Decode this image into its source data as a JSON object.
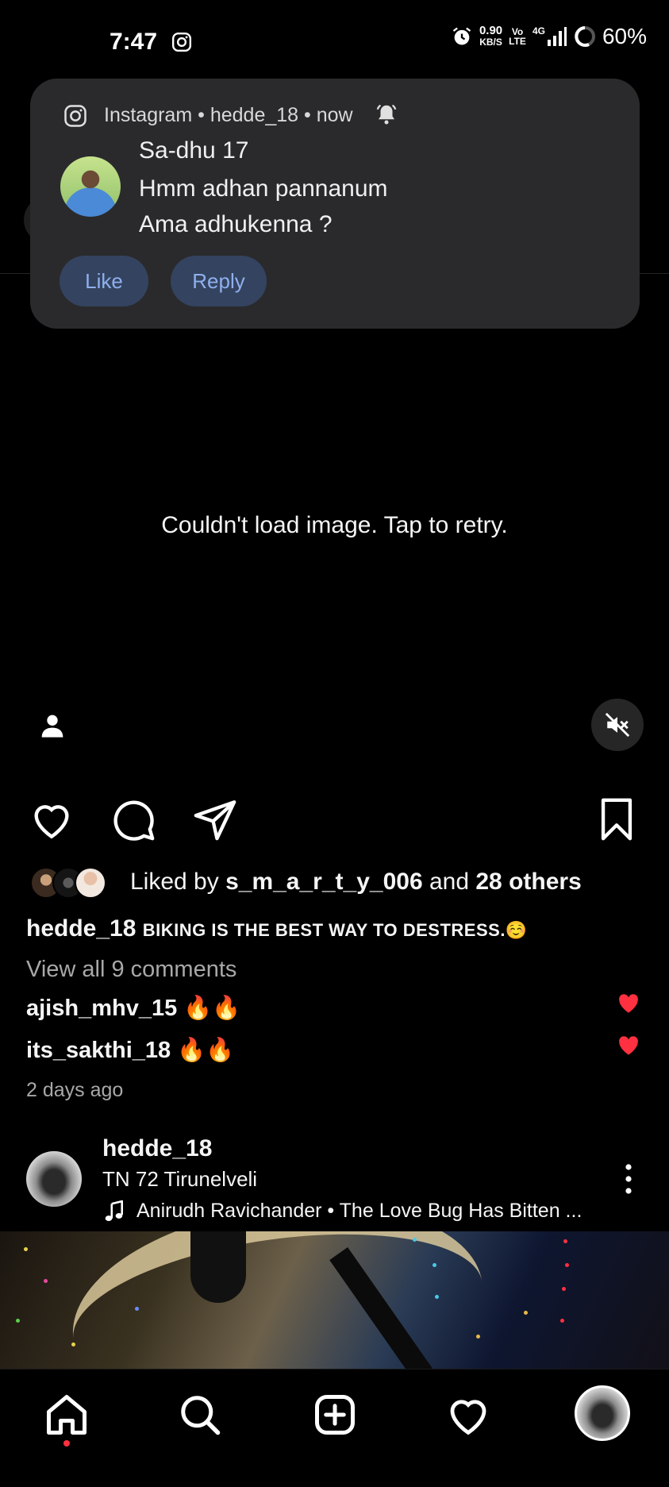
{
  "status_bar": {
    "time": "7:47",
    "net_speed_value": "0.90",
    "net_speed_unit": "KB/S",
    "volte_top": "Vo",
    "volte_bottom": "LTE",
    "network": "4G",
    "battery": "60%"
  },
  "notification": {
    "app": "Instagram",
    "account": "hedde_18",
    "time": "now",
    "sender": "Sa-dhu 17",
    "message_line1": "Hmm adhan pannanum",
    "message_line2": "Ama adhukenna ?",
    "actions": {
      "like": "Like",
      "reply": "Reply"
    },
    "button_color": "#34435f"
  },
  "post": {
    "error_message": "Couldn't load image. Tap to retry.",
    "liked_by_prefix": "Liked by ",
    "liked_by_user": "s_m_a_r_t_y_006",
    "liked_by_and": " and ",
    "liked_by_others": "28 others",
    "caption_user": "hedde_18",
    "caption_text": "BIKING IS THE BEST WAY TO DESTRESS.☺️",
    "view_comments": "View all 9 comments",
    "comments": [
      {
        "user": "ajish_mhv_15",
        "text": "🔥🔥"
      },
      {
        "user": "its_sakthi_18",
        "text": "🔥🔥"
      }
    ],
    "time_ago": "2 days ago"
  },
  "next_post": {
    "user": "hedde_18",
    "location": "TN 72 Tirunelveli",
    "music": "Anirudh Ravichander • The Love Bug Has Bitten ..."
  },
  "colors": {
    "background": "#000000",
    "like_red": "#ff3040",
    "secondary_text": "#a8a8a8"
  }
}
